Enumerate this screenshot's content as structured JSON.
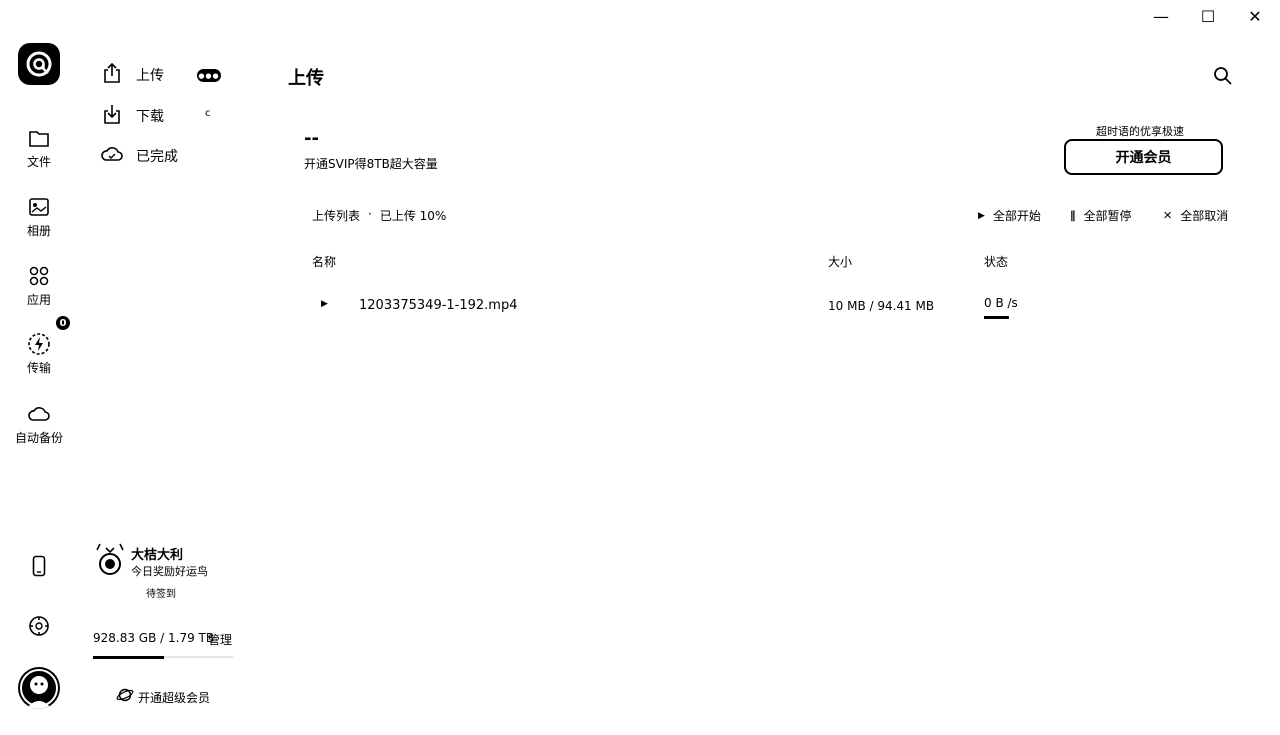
{
  "window": {
    "minimize": "—",
    "maximize": "☐",
    "close": "✕"
  },
  "rail": {
    "items": [
      {
        "label": "文件",
        "icon": "folder-icon"
      },
      {
        "label": "相册",
        "icon": "photo-icon"
      },
      {
        "label": "应用",
        "icon": "apps-icon"
      },
      {
        "label": "传输",
        "icon": "transfer-icon",
        "badge": "0"
      },
      {
        "label": "自动备份",
        "icon": "cloud-icon"
      }
    ]
  },
  "subnav": {
    "items": [
      {
        "label": "上传",
        "icon": "upload-icon",
        "extra": "●●●"
      },
      {
        "label": "下载",
        "icon": "download-icon",
        "extra": "c"
      },
      {
        "label": "已完成",
        "icon": "cloud-check-icon",
        "extra": ""
      }
    ]
  },
  "main": {
    "title": "上传",
    "speed": "--",
    "promo": "开通SVIP得8TB超大容量",
    "vip_hint": "超时语的优享极速",
    "vip_button": "开通会员",
    "list_title": "上传列表",
    "list_sep": "·",
    "list_status": "已上传 10%",
    "actions": {
      "start_all": "全部开始",
      "pause_all": "全部暂停",
      "cancel_all": "全部取消"
    },
    "columns": {
      "name": "名称",
      "size": "大小",
      "status": "状态"
    },
    "rows": [
      {
        "name": "1203375349-1-192.mp4",
        "size": "10 MB / 94.41 MB",
        "status": "0 B /s",
        "progress": 0.1
      }
    ]
  },
  "user": {
    "name": "大桔大利",
    "subtitle": "今日奖励好运鸟",
    "checkin": "待签到",
    "storage": "928.83 GB / 1.79 TB",
    "storage_fraction": 0.51,
    "manage": "管理",
    "upgrade": "开通超级会员"
  }
}
